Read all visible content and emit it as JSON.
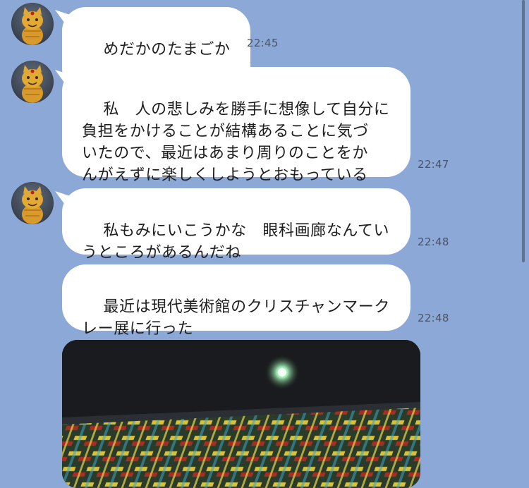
{
  "messages": [
    {
      "text": "めだかのたまごか",
      "time": "22:45"
    },
    {
      "text": "私　人の悲しみを勝手に想像して自分に\n負担をかけることが結構あることに気づ\nいたので、最近はあまり周りのことをか\nんがえずに楽しくしようとおもっている",
      "time": "22:47"
    },
    {
      "text": "私もみにいこうかな　眼科画廊なんてい\nうところがあるんだね",
      "time": "22:48"
    },
    {
      "text": "最近は現代美術館のクリスチャンマーク\nレー展に行った",
      "time": "22:48"
    }
  ],
  "photo": {
    "description_icon": "image-message"
  },
  "colors": {
    "background": "#8ca8d6",
    "bubble": "#ffffff",
    "text": "#1e1e1e",
    "time": "#4b5565"
  }
}
